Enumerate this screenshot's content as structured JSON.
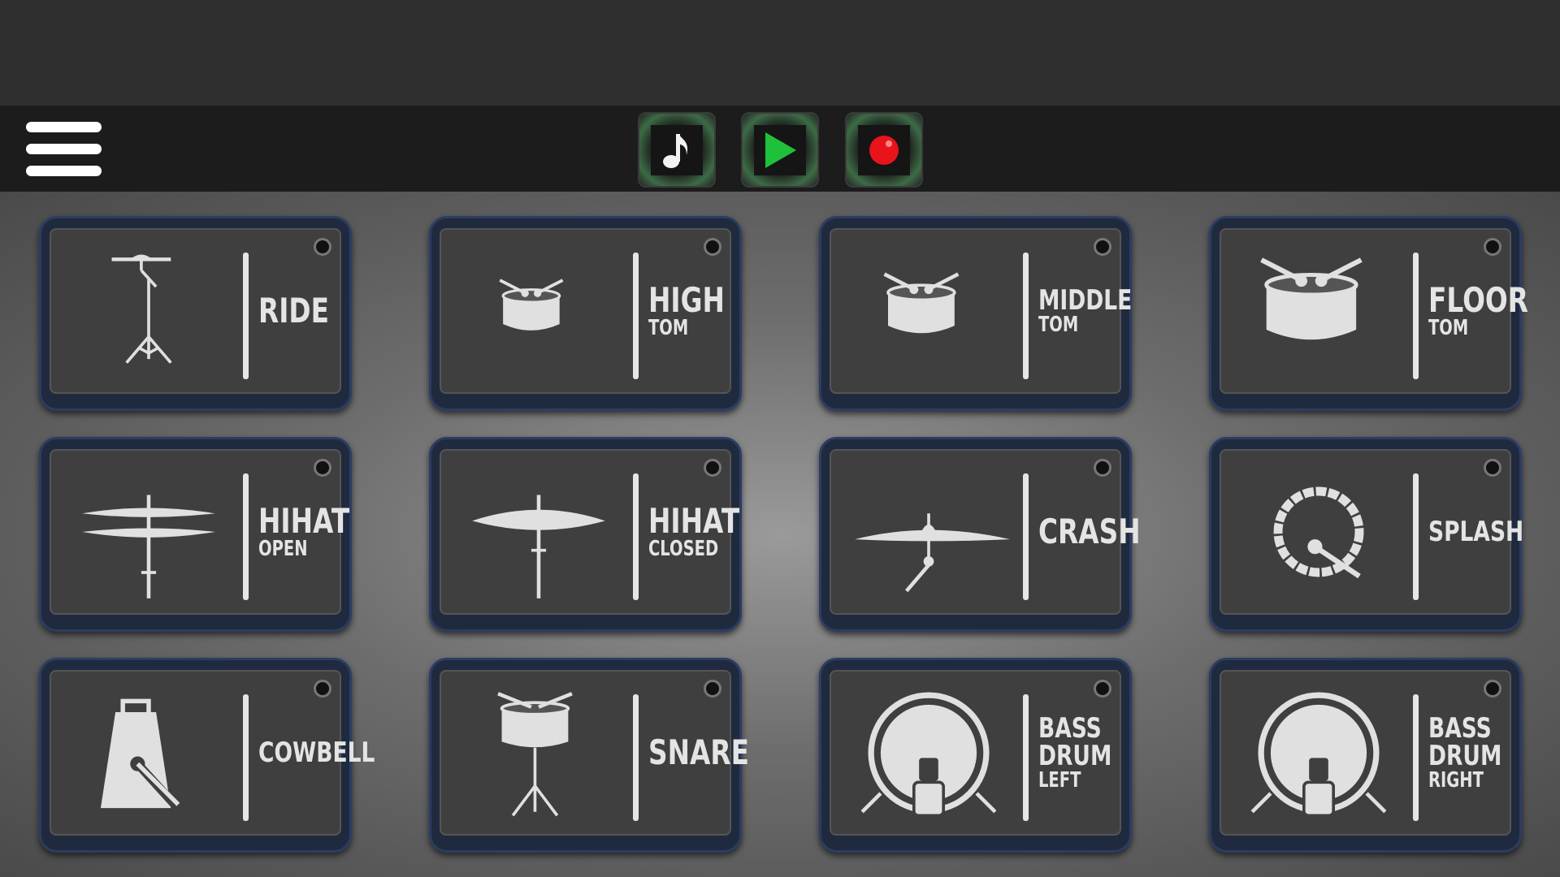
{
  "toolbar": {
    "menu_icon": "hamburger-menu-icon",
    "buttons": [
      {
        "name": "music-note",
        "icon": "music-note-icon",
        "color": "#f2f2f2"
      },
      {
        "name": "play",
        "icon": "play-icon",
        "color": "#1fc13c"
      },
      {
        "name": "record",
        "icon": "record-icon",
        "color": "#e8141a"
      }
    ]
  },
  "pads": [
    {
      "label": "RIDE",
      "sub": "",
      "icon": "ride-cymbal-icon"
    },
    {
      "label": "HIGH",
      "sub": "TOM",
      "icon": "high-tom-icon"
    },
    {
      "label": "MIDDLE",
      "sub": "TOM",
      "icon": "middle-tom-icon"
    },
    {
      "label": "FLOOR",
      "sub": "TOM",
      "icon": "floor-tom-icon"
    },
    {
      "label": "HIHAT",
      "sub": "OPEN",
      "icon": "hihat-open-icon"
    },
    {
      "label": "HIHAT",
      "sub": "CLOSED",
      "icon": "hihat-closed-icon"
    },
    {
      "label": "CRASH",
      "sub": "",
      "icon": "crash-cymbal-icon"
    },
    {
      "label": "SPLASH",
      "sub": "",
      "icon": "splash-icon"
    },
    {
      "label": "COWBELL",
      "sub": "",
      "icon": "cowbell-icon"
    },
    {
      "label": "SNARE",
      "sub": "",
      "icon": "snare-icon"
    },
    {
      "label": "BASS",
      "label2": "DRUM",
      "sub": "LEFT",
      "icon": "bass-drum-left-icon"
    },
    {
      "label": "BASS",
      "label2": "DRUM",
      "sub": "RIGHT",
      "icon": "bass-drum-right-icon"
    }
  ],
  "colors": {
    "pad_border": "#2b3d63",
    "pad_face": "#3f3f40",
    "toolbar": "#1c1c1c",
    "glow": "#3d6b46"
  }
}
